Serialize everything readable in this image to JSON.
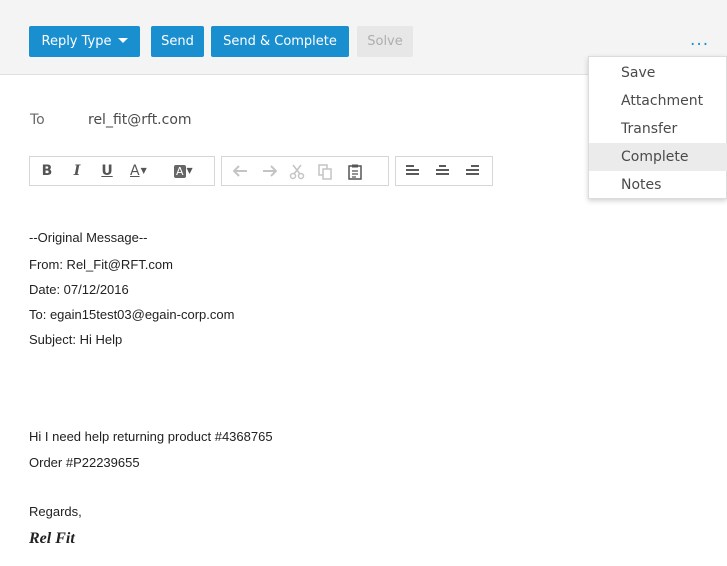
{
  "toolbar": {
    "reply_type_label": "Reply Type",
    "send_label": "Send",
    "send_complete_label": "Send & Complete",
    "solve_label": "Solve",
    "more_label": "..."
  },
  "menu": {
    "items": [
      {
        "label": "Save"
      },
      {
        "label": "Attachment"
      },
      {
        "label": "Transfer"
      },
      {
        "label": "Complete",
        "highlighted": true
      },
      {
        "label": "Notes"
      }
    ]
  },
  "recipient": {
    "label": "To",
    "value": "rel_fit@rft.com"
  },
  "editor_toolbar": {
    "bold": "B",
    "italic": "I",
    "underline": "U",
    "font_color": "A",
    "background_color": "A"
  },
  "message": {
    "lines": [
      "--Original Message--",
      "From: Rel_Fit@RFT.com",
      "Date: 07/12/2016",
      "To: egain15test03@egain-corp.com",
      "Subject: Hi Help",
      "Hi I need help returning product #4368765",
      "Order #P22239655",
      "Regards,"
    ],
    "signature": "Rel Fit"
  },
  "colors": {
    "accent": "#1a8fd0",
    "disabled_bg": "#e7e7e7",
    "toolbar_bg": "#f4f4f4",
    "menu_highlight": "#ebebeb"
  }
}
